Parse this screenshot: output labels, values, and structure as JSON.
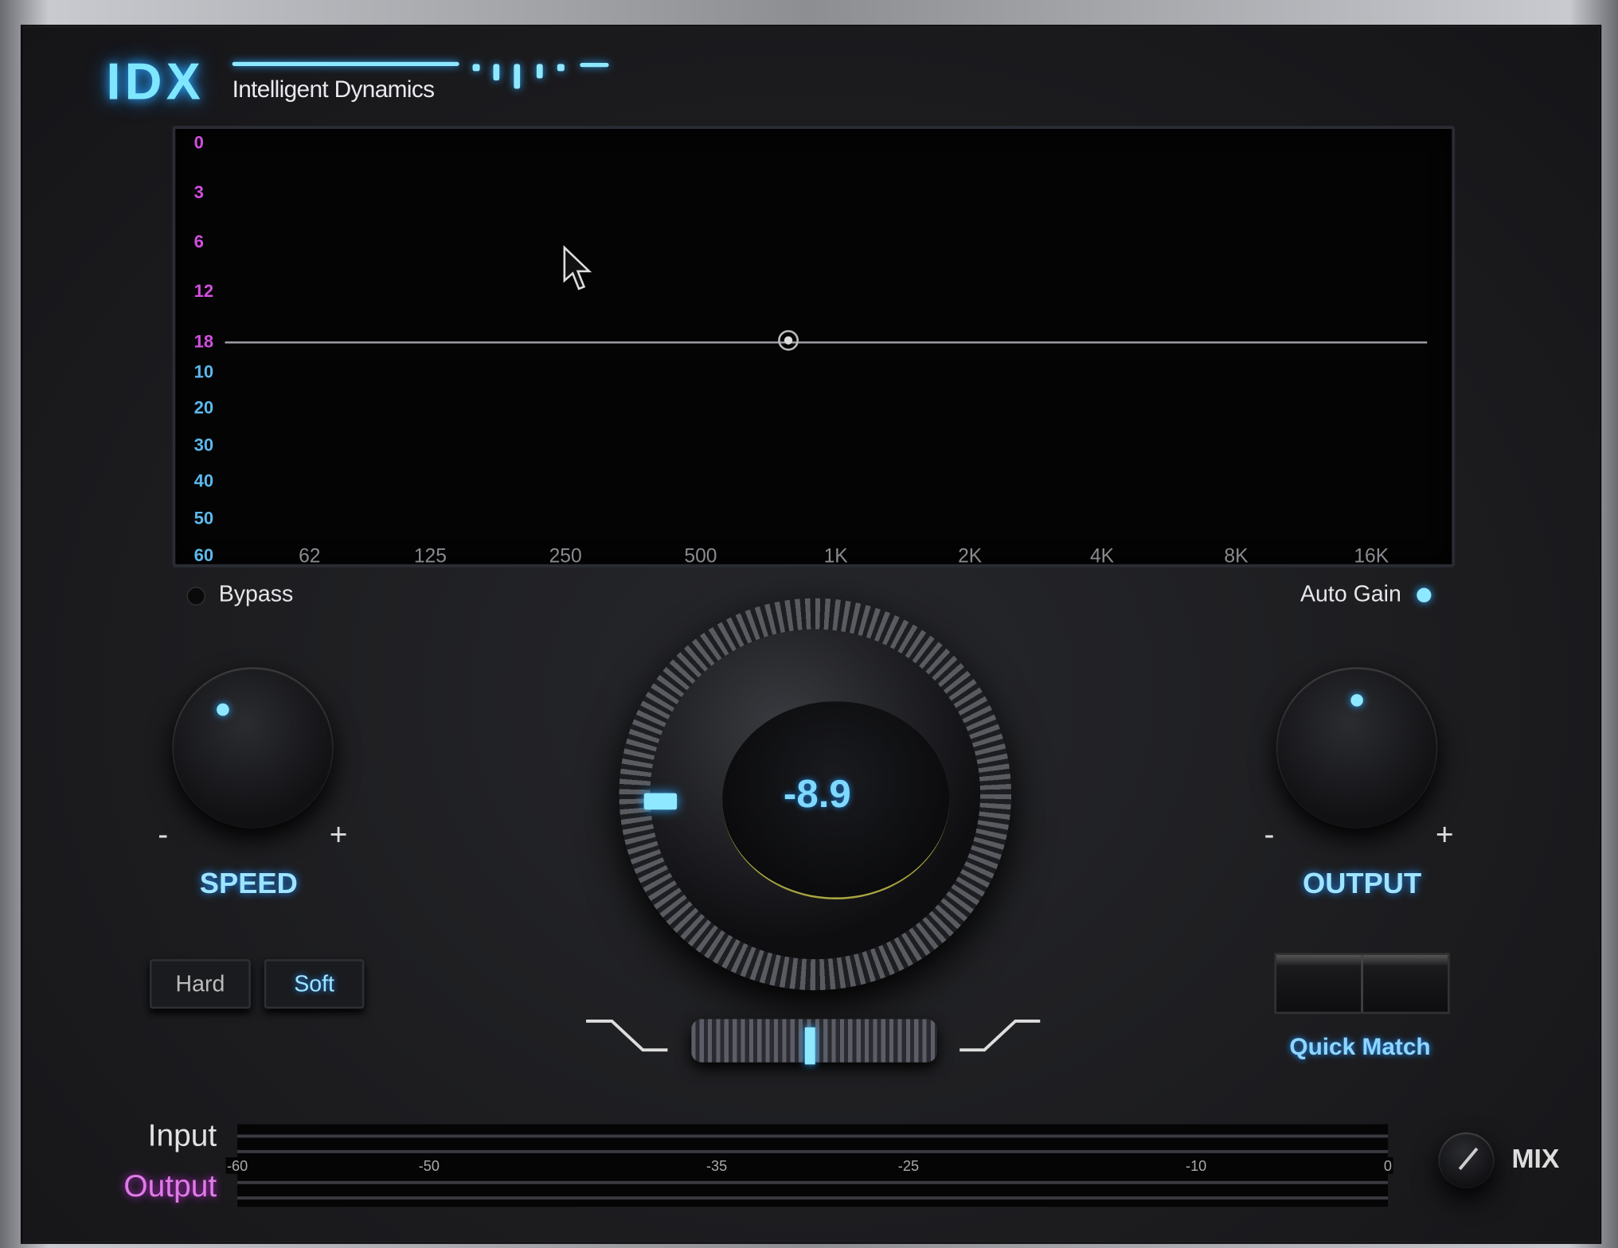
{
  "header": {
    "logo": "IDX",
    "tagline": "Intelligent Dynamics"
  },
  "display": {
    "y_labels_threshold": [
      "0",
      "3",
      "6",
      "12",
      "18"
    ],
    "y_labels_ratio": [
      "10",
      "20",
      "30",
      "40",
      "50",
      "60"
    ],
    "x_labels": [
      "62",
      "125",
      "250",
      "500",
      "1K",
      "2K",
      "4K",
      "8K",
      "16K"
    ]
  },
  "bypass": {
    "label": "Bypass",
    "active": false
  },
  "auto_gain": {
    "label": "Auto Gain",
    "active": true
  },
  "speed": {
    "label": "SPEED",
    "minus": "-",
    "plus": "+"
  },
  "main_knob": {
    "value": "-8.9"
  },
  "output": {
    "label": "OUTPUT",
    "minus": "-",
    "plus": "+"
  },
  "mode": {
    "hard": "Hard",
    "soft": "Soft",
    "selected": "Soft"
  },
  "quick_match": {
    "label": "Quick Match"
  },
  "meters": {
    "input_label": "Input",
    "output_label": "Output",
    "scale": [
      "-60",
      "-50",
      "-35",
      "-25",
      "-10",
      "0"
    ]
  },
  "mix": {
    "label": "MIX"
  },
  "colors": {
    "accent": "#8ee8ff",
    "threshold": "#d34fe0",
    "ratio": "#5cb9ec",
    "output_label": "#e07be8"
  }
}
